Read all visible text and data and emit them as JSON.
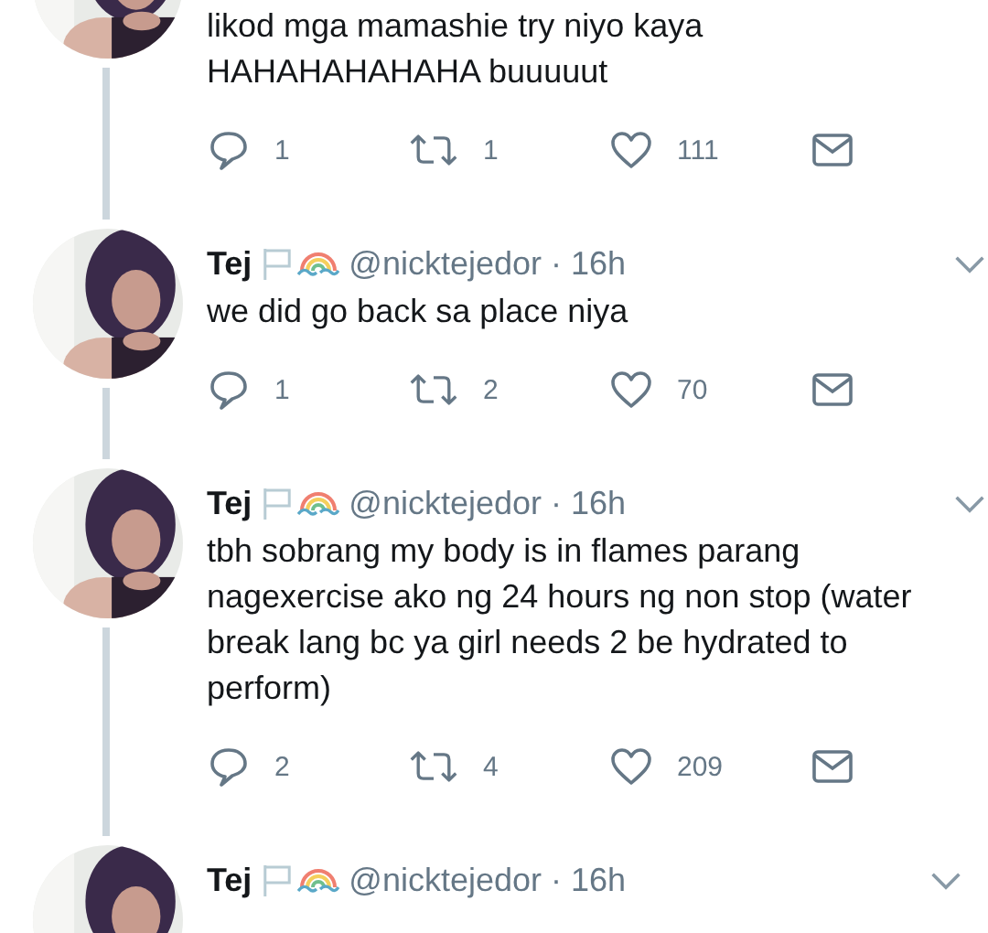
{
  "tweets": [
    {
      "text": "likod mga mamashie try niyo kaya\nHAHAHAHAHAHA buuuuut",
      "replies": "1",
      "retweets": "1",
      "likes": "111"
    },
    {
      "name": "Tej",
      "handle": "@nicktejedor",
      "dot": "·",
      "time": "16h",
      "text": "we did go back sa place niya",
      "replies": "1",
      "retweets": "2",
      "likes": "70"
    },
    {
      "name": "Tej",
      "handle": "@nicktejedor",
      "dot": "·",
      "time": "16h",
      "text": "tbh sobrang my body is in flames parang\nnagexercise ako ng 24 hours ng non stop (water\nbreak lang bc ya girl needs 2 be hydrated to\nperform)",
      "replies": "2",
      "retweets": "4",
      "likes": "209"
    },
    {
      "name": "Tej",
      "handle": "@nicktejedor",
      "dot": "·",
      "time": "16h"
    }
  ]
}
